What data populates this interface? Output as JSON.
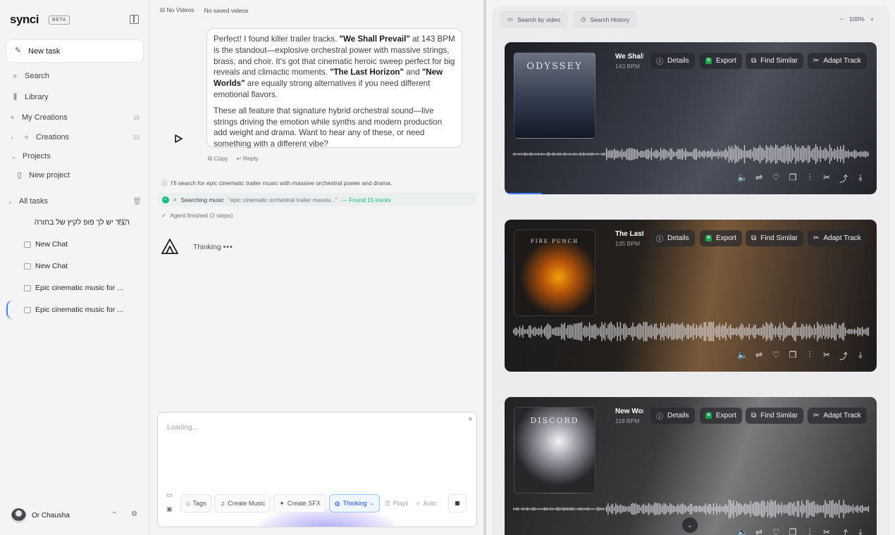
{
  "sidebar": {
    "logo": "synci",
    "beta": "BETA",
    "new_task": "New task",
    "nav": [
      {
        "label": "Search",
        "icon": "search-icon"
      },
      {
        "label": "Library",
        "icon": "library-icon"
      },
      {
        "label": "My Creations",
        "icon": "sparkle-icon",
        "count": "15"
      },
      {
        "label": "Creations",
        "icon": "sparkle-icon",
        "count": "15"
      },
      {
        "label": "Projects",
        "icon": "chevron-down-icon"
      },
      {
        "label": "New project",
        "icon": "document-icon"
      }
    ],
    "all_tasks": "All tasks",
    "tasks": [
      "תגיד יש לך פופ לקיץ של בחורה",
      "New Chat",
      "New Chat",
      "Epic cinematic music for ...",
      "Epic cinematic music for ..."
    ],
    "user": "Or Chausha"
  },
  "chat": {
    "videos": "No Videos",
    "saved": "No saved videos",
    "message": {
      "p1_a": "Perfect! I found killer trailer tracks. ",
      "p1_b": "\"We Shall Prevail\"",
      "p1_c": " at 143 BPM is the standout—explosive orchestral power with massive strings, brass, and choir. It's got that cinematic heroic sweep perfect for big reveals and climactic moments. ",
      "p1_d": "\"The Last Horizon\"",
      "p1_e": " and ",
      "p1_f": "\"New Worlds\"",
      "p1_g": " are equally strong alternatives if you need different emotional flavors.",
      "p2": "These all feature that signature hybrid orchestral sound—live strings driving the emotion while synths and modern production add weight and drama. Want to hear any of these, or need something with a different vibe?"
    },
    "copy": "Copy",
    "reply": "Reply",
    "status_intro": "I'll search for epic cinematic trailer music with massive orchestral power and drama.",
    "searching": "Searching music",
    "query": "\"epic cinematic orchestral trailer massiv...\"",
    "found": "— Found 15 tracks",
    "finished": "Agent finished (2 steps)",
    "thinking": "Thinking",
    "composer": {
      "loading": "Loading...",
      "chips": [
        "Tags",
        "Create Music",
        "Create SFX",
        "Thinking",
        "Playli",
        "Auto"
      ]
    }
  },
  "right": {
    "tabs": [
      "Search by video",
      "Search History"
    ],
    "zoom": "100%",
    "actions": [
      "Details",
      "Export",
      "Find Similar",
      "Adapt Track"
    ],
    "tracks": [
      {
        "name": "We Shall Prevail",
        "bpm": "143 BPM",
        "art": "ODYSSEY",
        "progress": 0.1
      },
      {
        "name": "The Last Horizon",
        "bpm": "135 BPM",
        "art": "FIRE PUNCH",
        "progress": 0
      },
      {
        "name": "New Worlds",
        "bpm": "118 BPM",
        "art": "DISCORD",
        "progress": 0
      }
    ]
  }
}
